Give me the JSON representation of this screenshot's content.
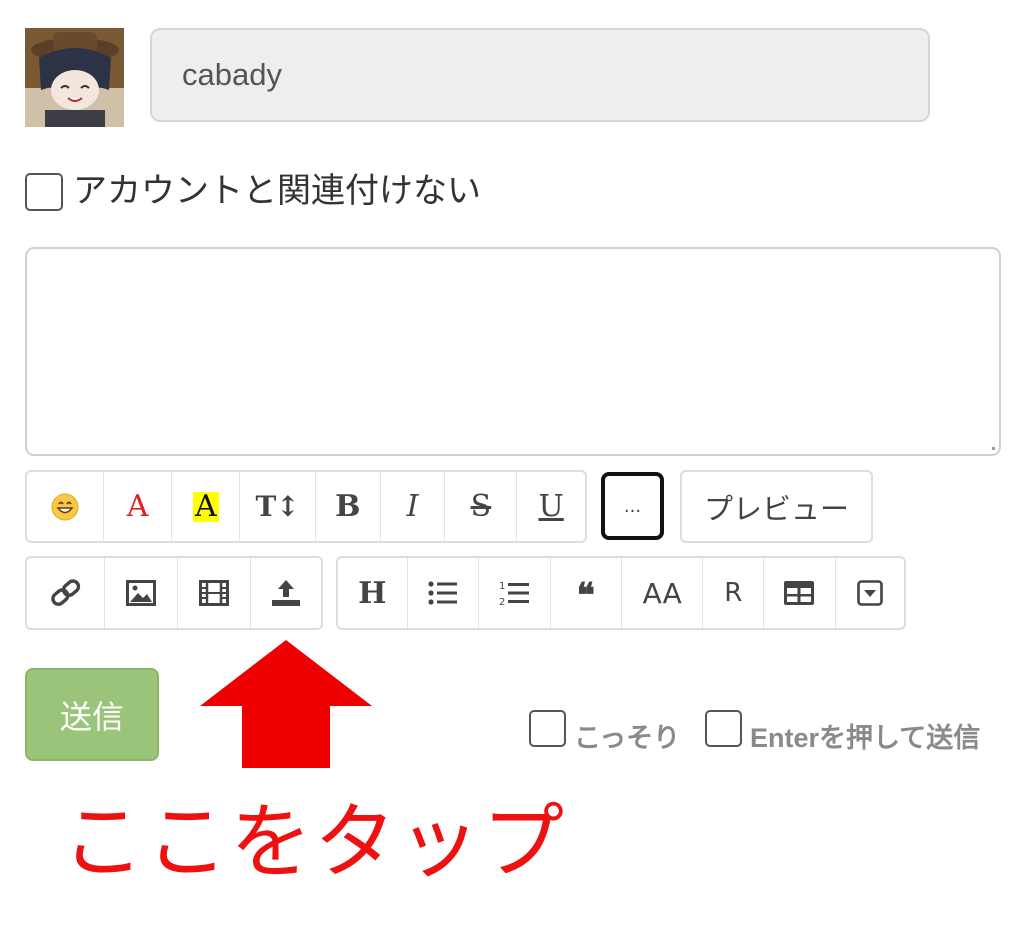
{
  "user": {
    "name_value": "cabady"
  },
  "anon_option": {
    "label": "アカウントと関連付けない"
  },
  "toolbar_row1": [
    {
      "name": "emoji-button",
      "icon": "emoji-smile-icon",
      "label": "😄"
    },
    {
      "name": "font-color-button",
      "icon": "font-color-icon",
      "label": "A",
      "color": "#e02020"
    },
    {
      "name": "highlight-button",
      "icon": "highlight-icon",
      "label": "A",
      "bg": "#ffff00"
    },
    {
      "name": "font-size-button",
      "icon": "font-size-icon",
      "label": "T↕"
    },
    {
      "name": "bold-button",
      "icon": "bold-icon",
      "label": "B"
    },
    {
      "name": "italic-button",
      "icon": "italic-icon",
      "label": "I"
    },
    {
      "name": "strikethrough-button",
      "icon": "strikethrough-icon",
      "label": "S"
    },
    {
      "name": "underline-button",
      "icon": "underline-icon",
      "label": "U"
    }
  ],
  "more_button": {
    "label": "..."
  },
  "preview_button": {
    "label": "プレビュー"
  },
  "toolbar_row2_left": [
    {
      "name": "link-button",
      "icon": "link-icon"
    },
    {
      "name": "image-button",
      "icon": "image-icon"
    },
    {
      "name": "video-button",
      "icon": "film-icon"
    },
    {
      "name": "upload-button",
      "icon": "upload-icon"
    }
  ],
  "toolbar_row2_right": [
    {
      "name": "heading-button",
      "icon": "heading-icon",
      "label": "H"
    },
    {
      "name": "bullet-list-button",
      "icon": "bullet-list-icon"
    },
    {
      "name": "numbered-list-button",
      "icon": "numbered-list-icon"
    },
    {
      "name": "quote-button",
      "icon": "quote-icon",
      "label": "❝"
    },
    {
      "name": "aa-button",
      "icon": "aa-icon",
      "label": "AA"
    },
    {
      "name": "ruby-button",
      "icon": "ruby-icon",
      "label": "R"
    },
    {
      "name": "table-button",
      "icon": "table-icon"
    },
    {
      "name": "collapse-button",
      "icon": "dropdown-box-icon"
    }
  ],
  "submit": {
    "label": "送信"
  },
  "options": {
    "sneaky_label": "こっそり",
    "enter_label": "Enterを押して送信"
  },
  "annotation": {
    "text": "ここをタップ",
    "color": "#ee1111"
  }
}
